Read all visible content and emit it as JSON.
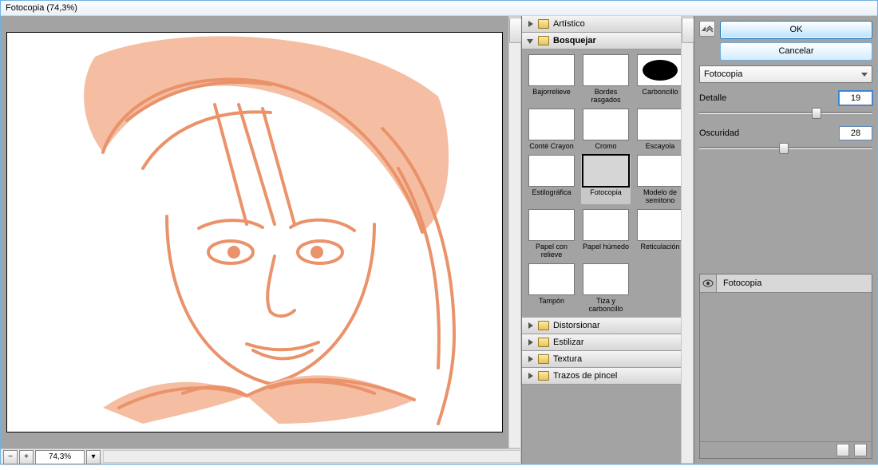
{
  "window": {
    "title": "Fotocopia (74,3%)"
  },
  "zoom": {
    "minus": "−",
    "plus": "+",
    "value": "74,3%",
    "dd": "▾"
  },
  "categories": {
    "artistico": "Artístico",
    "bosquejar": "Bosquejar",
    "distorsionar": "Distorsionar",
    "estilizar": "Estilizar",
    "textura": "Textura",
    "trazos": "Trazos de pincel"
  },
  "thumbs": [
    {
      "label": "Bajorrelieve"
    },
    {
      "label": "Bordes rasgados"
    },
    {
      "label": "Carboncillo"
    },
    {
      "label": "Conté Crayon"
    },
    {
      "label": "Cromo"
    },
    {
      "label": "Escayola"
    },
    {
      "label": "Estilográfica"
    },
    {
      "label": "Fotocopia"
    },
    {
      "label": "Modelo de semitono"
    },
    {
      "label": "Papel con relieve"
    },
    {
      "label": "Papel húmedo"
    },
    {
      "label": "Reticulación"
    },
    {
      "label": "Tampón"
    },
    {
      "label": "Tiza y carboncillo"
    }
  ],
  "buttons": {
    "ok": "OK",
    "cancel": "Cancelar"
  },
  "filterSelect": "Fotocopia",
  "sliders": {
    "detalle": {
      "label": "Detalle",
      "value": "19",
      "pos": 65
    },
    "oscuridad": {
      "label": "Oscuridad",
      "value": "28",
      "pos": 46
    }
  },
  "layer": {
    "name": "Fotocopia"
  }
}
